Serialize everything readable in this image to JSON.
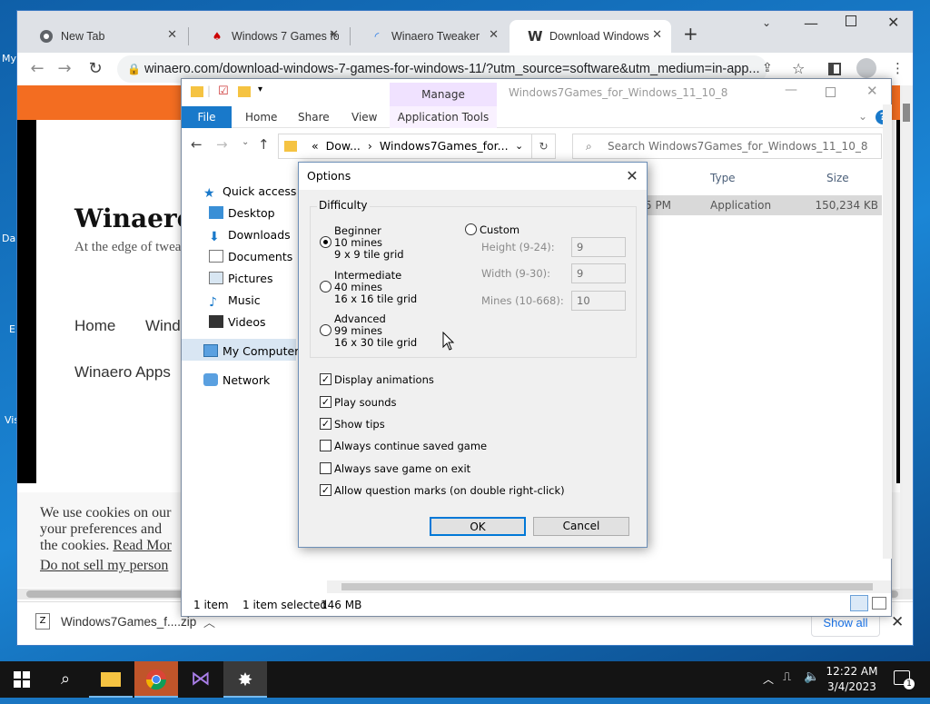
{
  "desktop": {
    "icon_labels": [
      "My",
      "Da",
      "E",
      "Vis"
    ]
  },
  "browser": {
    "tabs": [
      {
        "title": "New Tab",
        "icon": "chrome-icon"
      },
      {
        "title": "Windows 7 Games fo",
        "icon": "cards-icon"
      },
      {
        "title": "Winaero Tweaker",
        "icon": "loading-icon"
      },
      {
        "title": "Download Windows",
        "icon": "winaero-w-icon",
        "active": true
      }
    ],
    "new_tab": "+",
    "url": "winaero.com/download-windows-7-games-for-windows-11/?utm_source=software&utm_medium=in-app..."
  },
  "webpage": {
    "site_title": "Winaero",
    "tagline": "At the edge of twea",
    "nav": [
      "Home",
      "Wind",
      "Winaero Apps"
    ],
    "cookie": {
      "line1": "We use cookies on our",
      "line2": "your preferences and",
      "line3_prefix": "the cookies. ",
      "read_more": "Read Mor",
      "do_not_sell": "Do not sell my person"
    }
  },
  "downloads": {
    "file": "Windows7Games_f....zip",
    "show_all": "Show all"
  },
  "explorer": {
    "title": "Windows7Games_for_Windows_11_10_8",
    "manage": "Manage",
    "ribbon_tabs": [
      "File",
      "Home",
      "Share",
      "View"
    ],
    "app_tools": "Application Tools",
    "address": [
      "«",
      "Dow...",
      "›",
      "Windows7Games_for..."
    ],
    "search_placeholder": "Search Windows7Games_for_Windows_11_10_8",
    "nav_items": [
      "Quick access",
      "Desktop",
      "Downloads",
      "Documents",
      "Pictures",
      "Music",
      "Videos",
      "My Computer",
      "Network"
    ],
    "columns": [
      "Type",
      "Size"
    ],
    "file_row": {
      "time": "5 PM",
      "type": "Application",
      "size": "150,234 KB"
    },
    "status": {
      "count": "1 item",
      "selected": "1 item selected",
      "size": "146 MB"
    }
  },
  "dialog": {
    "title": "Options",
    "difficulty_label": "Difficulty",
    "levels": [
      {
        "name": "Beginner",
        "mines": "10 mines",
        "grid": "9 x 9 tile grid",
        "selected": true
      },
      {
        "name": "Intermediate",
        "mines": "40 mines",
        "grid": "16 x 16 tile grid",
        "selected": false
      },
      {
        "name": "Advanced",
        "mines": "99 mines",
        "grid": "16 x 30 tile grid",
        "selected": false
      }
    ],
    "custom": {
      "label": "Custom",
      "height_label": "Height (9-24):",
      "height_value": "9",
      "width_label": "Width (9-30):",
      "width_value": "9",
      "mines_label": "Mines (10-668):",
      "mines_value": "10"
    },
    "options": [
      {
        "label": "Display animations",
        "checked": true
      },
      {
        "label": "Play sounds",
        "checked": true
      },
      {
        "label": "Show tips",
        "checked": true
      },
      {
        "label": "Always continue saved game",
        "checked": false
      },
      {
        "label": "Always save game on exit",
        "checked": false
      },
      {
        "label": "Allow question marks (on double right-click)",
        "checked": true
      }
    ],
    "ok": "OK",
    "cancel": "Cancel"
  },
  "taskbar": {
    "time": "12:22 AM",
    "date": "3/4/2023",
    "notification_count": "1"
  },
  "colors": {
    "accent": "#0078d7",
    "winaero_orange": "#f36d21",
    "ribbon_file": "#1979ca"
  }
}
